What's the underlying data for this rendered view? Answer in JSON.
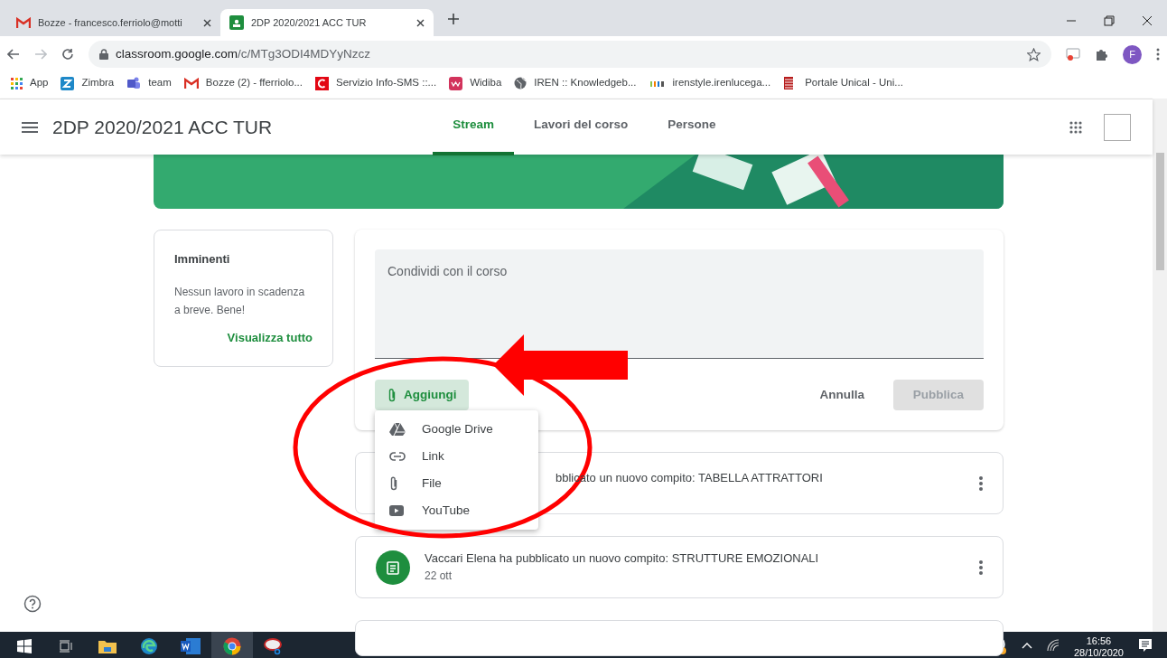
{
  "browser": {
    "tabs": [
      {
        "title": "Bozze - francesco.ferriolo@motti",
        "selected": false,
        "kind": "gmail"
      },
      {
        "title": "2DP 2020/2021 ACC TUR",
        "selected": true,
        "kind": "classroom"
      }
    ],
    "address": {
      "host": "classroom.google.com",
      "path": "/c/MTg3ODI4MDYyNzcz"
    },
    "profile_initial": "F",
    "bookmarks": [
      {
        "label": "App",
        "kind": "apps"
      },
      {
        "label": "Zimbra",
        "kind": "zimbra"
      },
      {
        "label": "team",
        "kind": "teams"
      },
      {
        "label": "Bozze (2) - fferriolo...",
        "kind": "gmail"
      },
      {
        "label": "Servizio Info-SMS ::...",
        "kind": "sms"
      },
      {
        "label": "Widiba",
        "kind": "widiba"
      },
      {
        "label": "IREN :: Knowledgeb...",
        "kind": "globe"
      },
      {
        "label": "irenstyle.irenlucega...",
        "kind": "iren"
      },
      {
        "label": "Portale Unical - Uni...",
        "kind": "unical"
      }
    ]
  },
  "classroom": {
    "title": "2DP 2020/2021 ACC TUR",
    "nav": [
      {
        "label": "Stream",
        "selected": true
      },
      {
        "label": "Lavori del corso",
        "selected": false
      },
      {
        "label": "Persone",
        "selected": false
      }
    ],
    "upcoming": {
      "title": "Imminenti",
      "text": "Nessun lavoro in scadenza a breve. Bene!",
      "link": "Visualizza tutto"
    },
    "composer": {
      "placeholder": "Condividi con il corso",
      "add_button": "Aggiungi",
      "cancel": "Annulla",
      "publish": "Pubblica",
      "publish_disabled": true,
      "menu": [
        {
          "label": "Google Drive",
          "kind": "drive"
        },
        {
          "label": "Link",
          "kind": "link"
        },
        {
          "label": "File",
          "kind": "file"
        },
        {
          "label": "YouTube",
          "kind": "youtube"
        }
      ]
    },
    "posts": [
      {
        "text": "bblicato un nuovo compito: TABELLA ATTRATTORI"
      },
      {
        "text": "Vaccari Elena ha pubblicato un nuovo compito: STRUTTURE EMOZIONALI",
        "date": "22 ott"
      }
    ]
  },
  "taskbar": {
    "time": "16:56",
    "date": "28/10/2020"
  }
}
